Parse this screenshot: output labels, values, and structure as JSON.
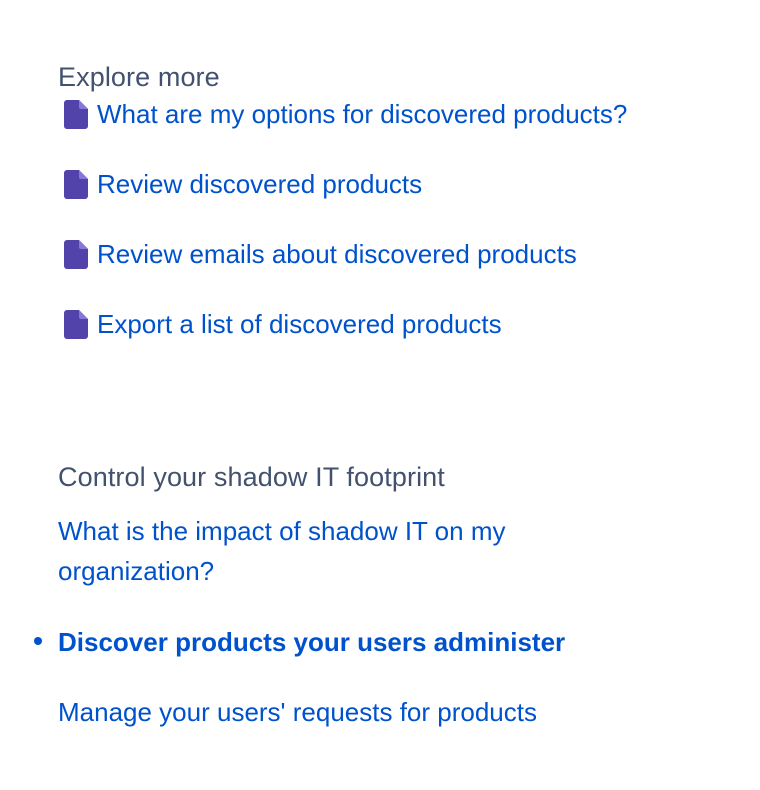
{
  "explore": {
    "heading": "Explore more",
    "links": [
      {
        "label": "What are my options for discovered products?",
        "icon": "page-icon"
      },
      {
        "label": "Review discovered products",
        "icon": "page-icon"
      },
      {
        "label": "Review emails about discovered products",
        "icon": "page-icon"
      },
      {
        "label": "Export a list of discovered products",
        "icon": "page-icon"
      }
    ]
  },
  "shadow_it": {
    "heading": "Control your shadow IT footprint",
    "intro_link": "What is the impact of shadow IT on my organization?",
    "nav": [
      {
        "label": "Discover products your users administer",
        "current": true
      },
      {
        "label": "Manage your users' requests for products",
        "current": false
      }
    ]
  },
  "colors": {
    "link": "#0052cc",
    "heading": "#42526e",
    "page_icon": "#5243aa",
    "bullet": "#0052cc"
  }
}
